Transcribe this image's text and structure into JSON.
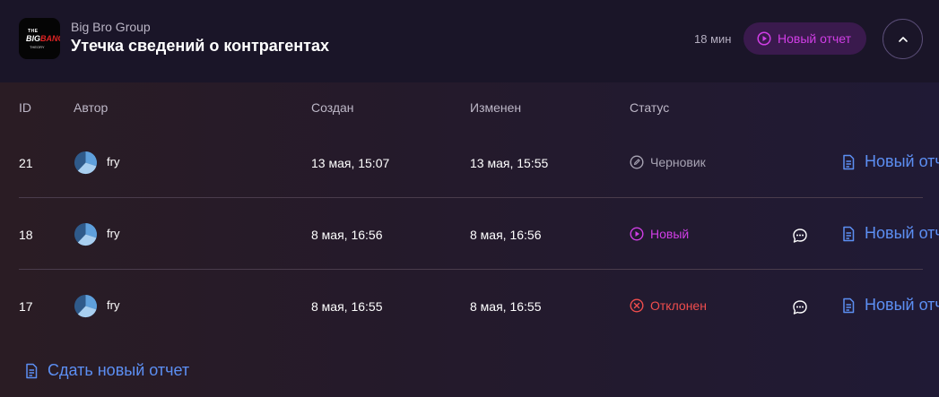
{
  "header": {
    "logo_line1": "THE",
    "logo_line2a": "BIG",
    "logo_line2b": "BANG",
    "logo_line3": "THEORY",
    "company": "Big Bro Group",
    "title": "Утечка сведений о контрагентах",
    "elapsed": "18 мин",
    "status_label": "Новый отчет",
    "status_icon": "play-circle-icon",
    "collapse_icon": "chevron-up-icon"
  },
  "table": {
    "columns": [
      "ID",
      "Автор",
      "Создан",
      "Изменен",
      "Статус"
    ],
    "rows": [
      {
        "id": "21",
        "author": "fry",
        "created": "13 мая, 15:07",
        "modified": "13 мая, 15:55",
        "status": "Черновик",
        "status_icon": "pencil-circle-icon",
        "status_color": "#a7a3b3",
        "has_chat": false,
        "action": "Новый отчет"
      },
      {
        "id": "18",
        "author": "fry",
        "created": "8 мая, 16:56",
        "modified": "8 мая, 16:56",
        "status": "Новый",
        "status_icon": "play-circle-icon",
        "status_color": "#d13ee6",
        "has_chat": true,
        "action": "Новый отчет"
      },
      {
        "id": "17",
        "author": "fry",
        "created": "8 мая, 16:55",
        "modified": "8 мая, 16:55",
        "status": "Отклонен",
        "status_icon": "x-circle-icon",
        "status_color": "#f04d4d",
        "has_chat": true,
        "action": "Новый отчет"
      }
    ]
  },
  "footer": {
    "submit_label": "Сдать новый отчет",
    "submit_icon": "document-icon"
  },
  "colors": {
    "accent_blue": "#5c8ff3",
    "accent_magenta": "#d13ee6",
    "danger": "#f04d4d"
  }
}
